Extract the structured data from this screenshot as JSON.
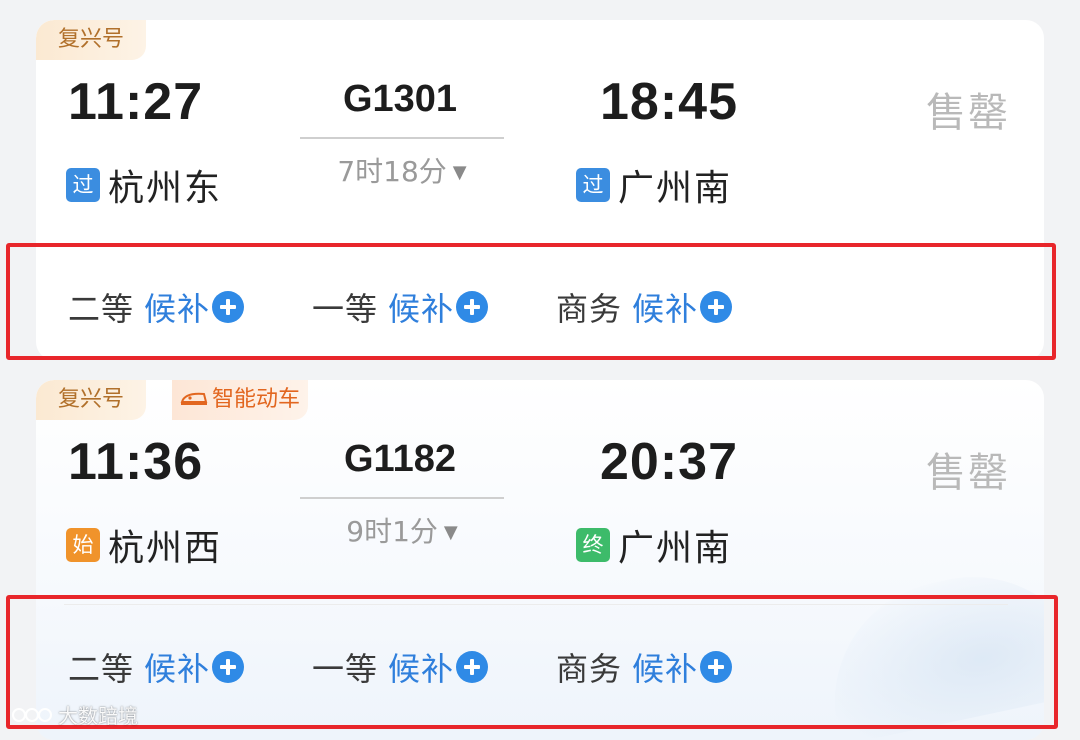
{
  "trains": [
    {
      "tags": [
        "复兴号"
      ],
      "depart_time": "11:27",
      "arrive_time": "18:45",
      "train_no": "G1301",
      "duration": "7时18分",
      "from": {
        "badge": "过",
        "badge_color": "#3b8de0",
        "name": "杭州东"
      },
      "to": {
        "badge": "过",
        "badge_color": "#3b8de0",
        "name": "广州南"
      },
      "status": "售罄",
      "seats": [
        {
          "class": "二等",
          "action": "候补"
        },
        {
          "class": "一等",
          "action": "候补"
        },
        {
          "class": "商务",
          "action": "候补"
        }
      ]
    },
    {
      "tags": [
        "复兴号",
        "智能动车"
      ],
      "depart_time": "11:36",
      "arrive_time": "20:37",
      "train_no": "G1182",
      "duration": "9时1分",
      "from": {
        "badge": "始",
        "badge_color": "#f0932b",
        "name": "杭州西"
      },
      "to": {
        "badge": "终",
        "badge_color": "#3dbb6a",
        "name": "广州南"
      },
      "status": "售罄",
      "seats": [
        {
          "class": "二等",
          "action": "候补"
        },
        {
          "class": "一等",
          "action": "候补"
        },
        {
          "class": "商务",
          "action": "候补"
        }
      ]
    }
  ],
  "colors": {
    "highlight_box": "#e8262b",
    "action_blue": "#2f7fdc",
    "plus_icon": "#2f8ae6"
  },
  "watermark": "大数踣境"
}
